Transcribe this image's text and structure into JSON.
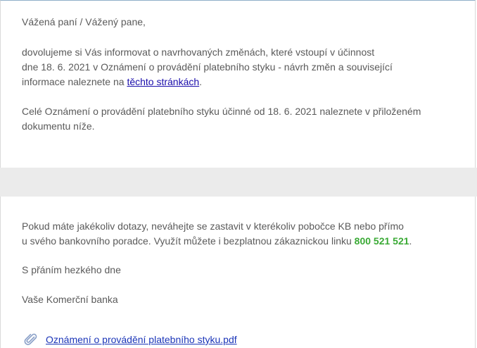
{
  "email": {
    "greeting": "Vážená paní / Vážený pane,",
    "para1_line1": "dovolujeme si Vás informovat o navrhovaných změnách, které vstoupí v účinnost",
    "para1_line2_before": "dne 18. 6. 2021 v Oznámení o provádění platebního styku - návrh změn a související",
    "para1_line3_before": "informace naleznete na ",
    "para1_link": "těchto stránkách",
    "para1_line3_after": ".",
    "para2_line1": "Celé Oznámení o provádění platebního styku účinné od 18. 6. 2021 naleznete v přiloženém",
    "para2_line2": "dokumentu níže.",
    "para3_line1": "Pokud máte jakékoliv dotazy, neváhejte se zastavit v kterékoliv pobočce KB nebo přímo",
    "para3_line2_before": "u svého bankovního poradce. Využít můžete i bezplatnou zákaznickou linku ",
    "phone": "800 521 521",
    "para3_line2_after": ".",
    "signoff": "S přáním hezkého dne",
    "signature": "Vaše Komerční banka"
  },
  "attachment": {
    "icon": "paperclip-icon",
    "filename": "Oznámení o provádění platebního styku.pdf"
  },
  "colors": {
    "text": "#5a5a5a",
    "link": "#1a0dab",
    "phone": "#3aaa35",
    "band": "#ebebeb"
  }
}
